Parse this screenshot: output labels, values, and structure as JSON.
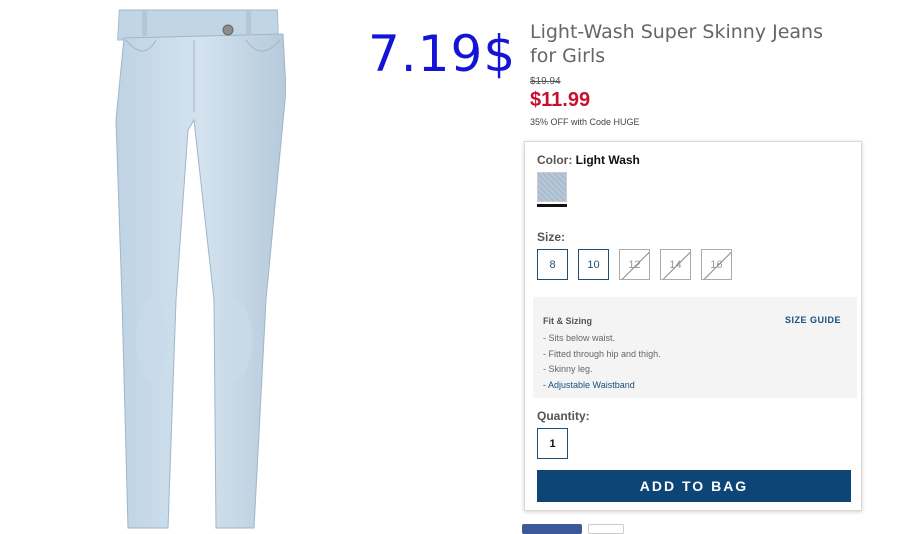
{
  "overlay_price": "7.19$",
  "product": {
    "title": "Light-Wash Super Skinny Jeans for Girls",
    "original_price": "$19.94",
    "sale_price": "$11.99",
    "promo": "35% OFF with Code HUGE"
  },
  "color": {
    "label": "Color:",
    "value": "Light Wash"
  },
  "size": {
    "label": "Size:",
    "options": [
      {
        "label": "8",
        "available": true
      },
      {
        "label": "10",
        "available": true
      },
      {
        "label": "12",
        "available": false
      },
      {
        "label": "14",
        "available": false
      },
      {
        "label": "16",
        "available": false
      }
    ]
  },
  "fit": {
    "title": "Fit & Sizing",
    "size_guide": "SIZE GUIDE",
    "items": [
      "- Sits below waist.",
      "- Fitted through hip and thigh.",
      "- Skinny leg.",
      "- Adjustable Waistband"
    ]
  },
  "quantity": {
    "label": "Quantity:",
    "value": "1"
  },
  "add_to_bag": "ADD TO BAG",
  "colors": {
    "accent": "#0c4576",
    "sale": "#c8102e",
    "overlay": "#1414d6"
  }
}
